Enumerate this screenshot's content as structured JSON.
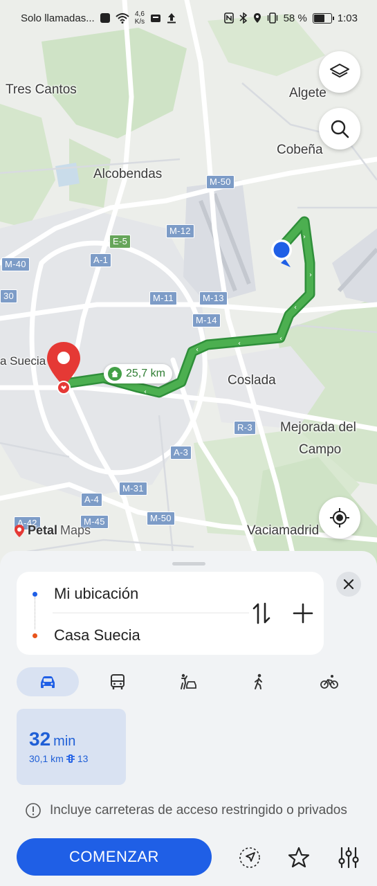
{
  "status_bar": {
    "carrier": "Solo llamadas...",
    "net_speed_value": "4,6",
    "net_speed_unit": "K/s",
    "battery": "58 %",
    "battery_level": 0.58,
    "time": "1:03"
  },
  "map": {
    "places": {
      "tres_cantos": "Tres Cantos",
      "algete": "Algete",
      "cobena": "Cobeña",
      "alcobendas": "Alcobendas",
      "coslada": "Coslada",
      "mejorada_1": "Mejorada del",
      "mejorada_2": "Campo",
      "vaciamadrid": "Vaciamadrid",
      "casa_suecia_partial": "a Suecia"
    },
    "roads": {
      "m50_top": "M-50",
      "m12": "M-12",
      "e5": "E-5",
      "a1": "A-1",
      "m40": "M-40",
      "m30": "30",
      "m11": "M-11",
      "m13": "M-13",
      "m14": "M-14",
      "r3": "R-3",
      "a3": "A-3",
      "m31": "M-31",
      "a4": "A-4",
      "m45": "M-45",
      "m50_bottom": "M-50",
      "a42": "A-42"
    },
    "route_distance": "25,7 km",
    "brand_petal": "Petal",
    "brand_maps": "Maps",
    "route_color": "#43a047",
    "accent_blue": "#1f5fe6"
  },
  "sheet": {
    "origin": "Mi ubicación",
    "destination": "Casa Suecia",
    "modes": [
      "car",
      "transit",
      "taxi",
      "walk",
      "bike"
    ],
    "active_mode": "car",
    "result": {
      "time_value": "32",
      "time_unit": "min",
      "distance": "30,1 km",
      "traffic_lights": "13"
    },
    "notice": "Incluye carreteras de acceso restringido o privados",
    "start_label": "COMENZAR"
  }
}
